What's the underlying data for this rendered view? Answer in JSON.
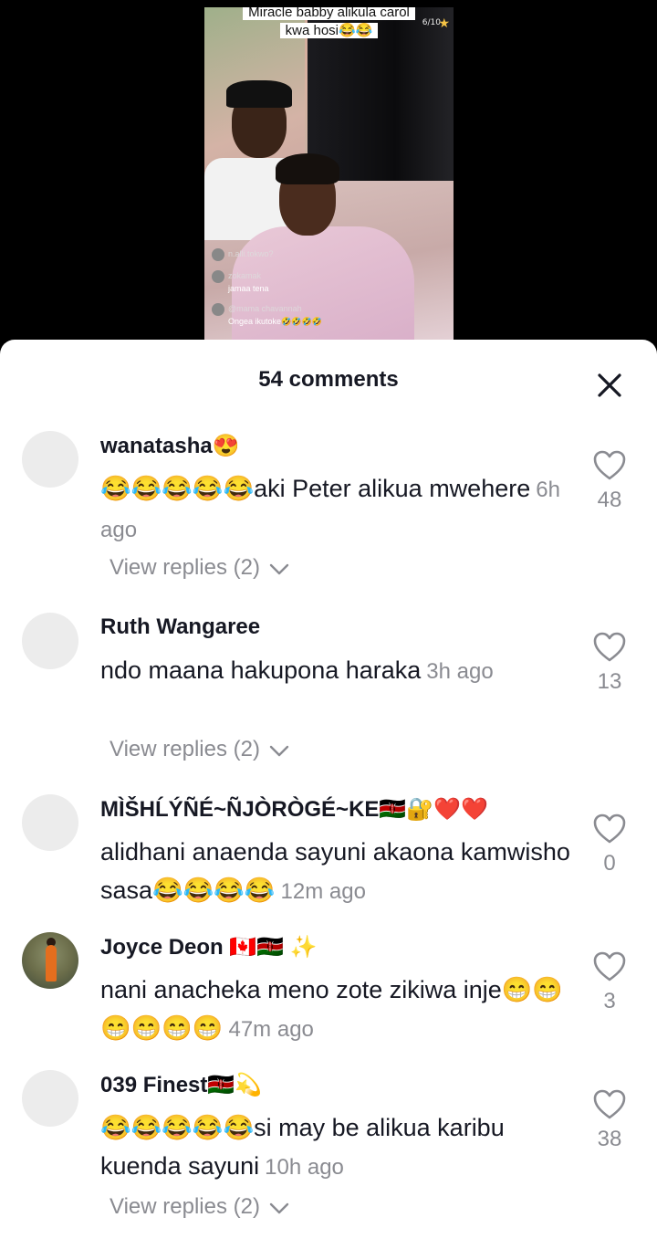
{
  "video": {
    "caption_line1": "Miracle babby alikula carol",
    "caption_line2": "kwa hosi😂😂",
    "counter": "6/10",
    "live_comments": [
      {
        "user": "n.alli.tokwo?",
        "text": ""
      },
      {
        "user": "zokamak",
        "text": "jamaa tena"
      },
      {
        "user": "@mama chavannah",
        "text": "Ongea ikutoke🤣🤣🤣🤣"
      }
    ]
  },
  "sheet": {
    "title": "54 comments"
  },
  "comments": [
    {
      "username": "wanatasha😍",
      "text": "😂😂😂😂😂aki Peter alikua mwehere",
      "time": "6h ago",
      "likes": "48",
      "replies": "View replies (2)"
    },
    {
      "username": "Ruth Wangaree",
      "text": "ndo maana hakupona haraka",
      "time": "3h ago",
      "likes": "13",
      "replies": "View replies (2)"
    },
    {
      "username": "MÌŠHĹÝÑÉ~ÑJÒRÒGÉ~KE🇰🇪🔐❤️❤️",
      "text": "alidhani anaenda sayuni akaona kamwisho sasa😂😂😂😂",
      "time": "12m ago",
      "likes": "0",
      "replies": ""
    },
    {
      "username": "Joyce Deon 🇨🇦🇰🇪 ✨",
      "text": "nani anacheka meno zote zikiwa inje😁😁😁😁😁😁",
      "time": "47m ago",
      "likes": "3",
      "replies": ""
    },
    {
      "username": "039 Finest🇰🇪💫",
      "text": "😂😂😂😂😂si may be alikua karibu kuenda sayuni",
      "time": "10h ago",
      "likes": "38",
      "replies": "View replies (2)"
    }
  ],
  "colors": {
    "primary_text": "#161823",
    "secondary_text": "#8a8b91",
    "sheet_bg": "#ffffff",
    "backdrop": "#000000"
  }
}
